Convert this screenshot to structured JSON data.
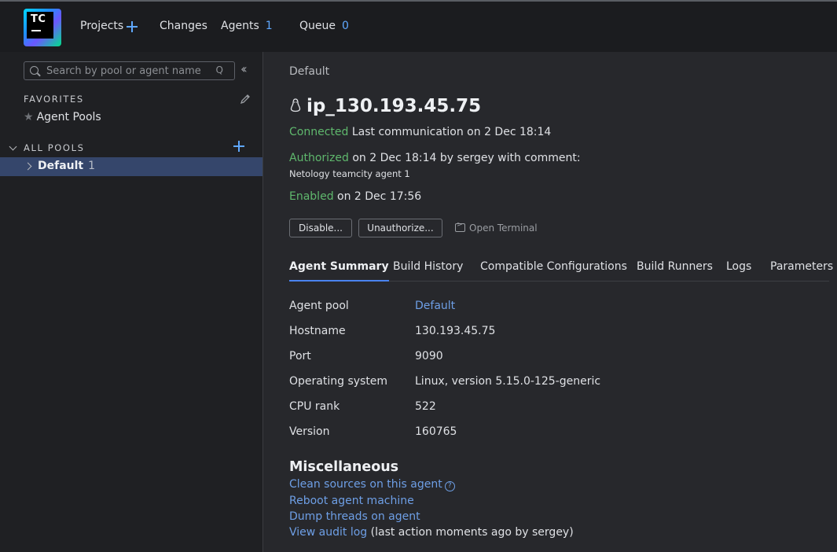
{
  "header": {
    "logo_text": "TC",
    "nav": {
      "projects": "Projects",
      "changes": "Changes",
      "agents": "Agents",
      "agents_count": "1",
      "queue": "Queue",
      "queue_count": "0"
    }
  },
  "sidebar": {
    "search_placeholder": "Search by pool or agent name",
    "search_shortcut": "Q",
    "favorites_label": "FAVORITES",
    "favorites_item": "Agent Pools",
    "all_pools_label": "ALL POOLS",
    "pool": {
      "name": "Default",
      "count": "1"
    }
  },
  "main": {
    "breadcrumb": "Default",
    "agent_name": "ip_130.193.45.75",
    "status": {
      "connected": "Connected",
      "connected_rest": "Last communication on 2 Dec 18:14",
      "authorized": "Authorized",
      "authorized_rest": "on 2 Dec 18:14 by sergey with comment:",
      "comment": "Netology teamcity agent 1",
      "enabled": "Enabled",
      "enabled_rest": "on 2 Dec 17:56"
    },
    "buttons": {
      "disable": "Disable...",
      "unauthorize": "Unauthorize...",
      "open_terminal": "Open Terminal"
    },
    "tabs": [
      "Agent Summary",
      "Build History",
      "Compatible Configurations",
      "Build Runners",
      "Logs",
      "Parameters"
    ],
    "summary": [
      {
        "key": "Agent pool",
        "value": "Default"
      },
      {
        "key": "Hostname",
        "value": "130.193.45.75"
      },
      {
        "key": "Port",
        "value": "9090"
      },
      {
        "key": "Operating system",
        "value": "Linux, version 5.15.0-125-generic"
      },
      {
        "key": "CPU rank",
        "value": "522"
      },
      {
        "key": "Version",
        "value": "160765"
      }
    ],
    "misc": {
      "title": "Miscellaneous",
      "clean_sources": "Clean sources on this agent",
      "reboot": "Reboot agent machine",
      "dump_threads": "Dump threads on agent",
      "audit_link": "View audit log",
      "audit_rest": "(last action moments ago by sergey)"
    }
  }
}
